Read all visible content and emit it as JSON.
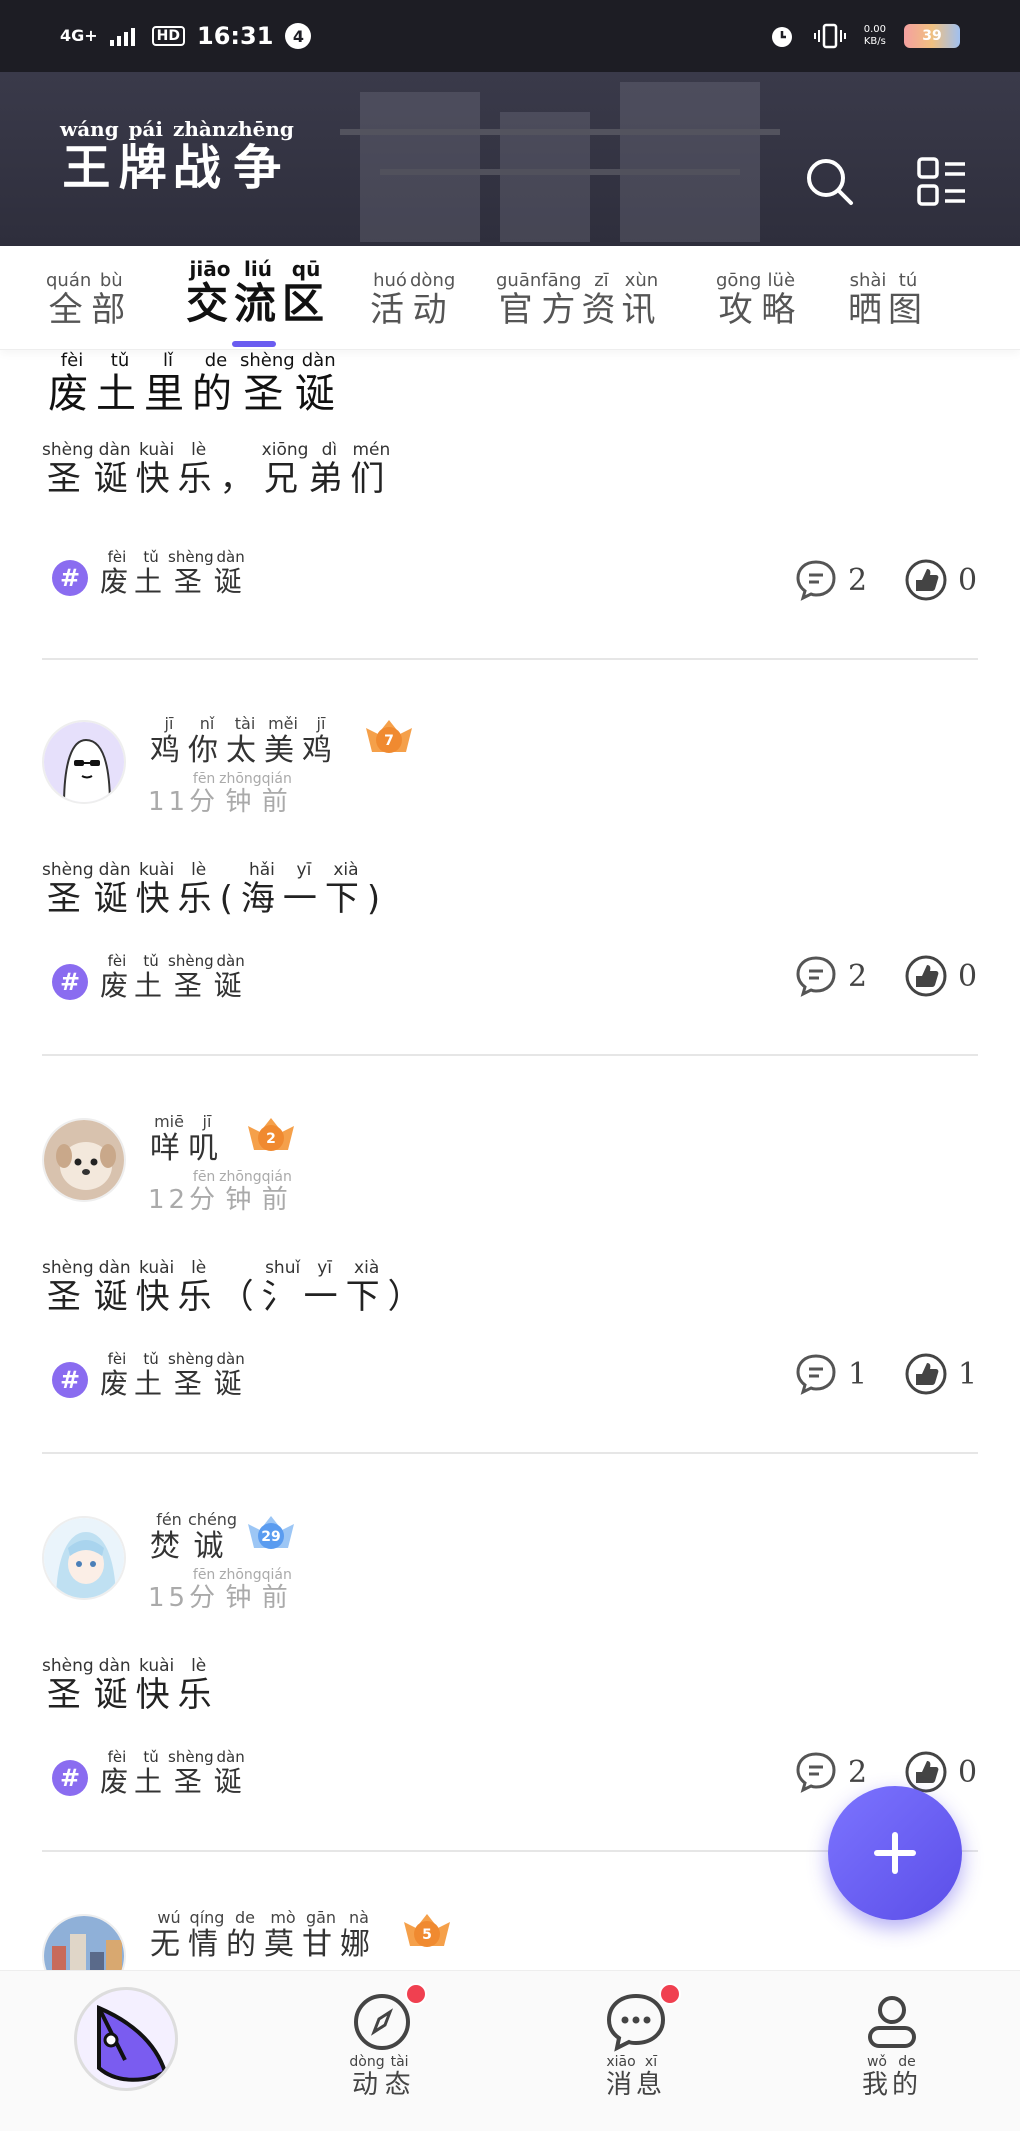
{
  "status_bar": {
    "network": "4G+",
    "hd": "HD",
    "time": "16:31",
    "notif_count": "4",
    "speed_value": "0.00",
    "speed_unit": "KB/s",
    "battery": "39"
  },
  "header": {
    "title_chars": [
      {
        "hz": "王",
        "py": "wáng"
      },
      {
        "hz": "牌",
        "py": "pái"
      },
      {
        "hz": "战",
        "py": "zhàn"
      },
      {
        "hz": "争",
        "py": "zhēng"
      }
    ],
    "search_icon": "search-icon",
    "menu_icon": "grid-menu-icon"
  },
  "tabs": [
    {
      "chars": [
        {
          "hz": "全",
          "py": "quán"
        },
        {
          "hz": "部",
          "py": "bù"
        }
      ]
    },
    {
      "chars": [
        {
          "hz": "交",
          "py": "jiāo"
        },
        {
          "hz": "流",
          "py": "liú"
        },
        {
          "hz": "区",
          "py": "qū"
        }
      ],
      "active": true
    },
    {
      "chars": [
        {
          "hz": "活",
          "py": "huó"
        },
        {
          "hz": "动",
          "py": "dòng"
        }
      ]
    },
    {
      "chars": [
        {
          "hz": "官",
          "py": "guān"
        },
        {
          "hz": "方",
          "py": "fāng"
        },
        {
          "hz": "资",
          "py": "zī"
        },
        {
          "hz": "讯",
          "py": "xùn"
        }
      ]
    },
    {
      "chars": [
        {
          "hz": "攻",
          "py": "gōng"
        },
        {
          "hz": "略",
          "py": "lüè"
        }
      ]
    },
    {
      "chars": [
        {
          "hz": "晒",
          "py": "shài"
        },
        {
          "hz": "图",
          "py": "tú"
        }
      ]
    }
  ],
  "posts": [
    {
      "title": [
        {
          "hz": "废",
          "py": "fèi"
        },
        {
          "hz": "土",
          "py": "tǔ"
        },
        {
          "hz": "里",
          "py": "lǐ"
        },
        {
          "hz": "的",
          "py": "de"
        },
        {
          "hz": "圣",
          "py": "shèng"
        },
        {
          "hz": "诞",
          "py": "dàn"
        }
      ],
      "text": [
        {
          "hz": "圣",
          "py": "shèng"
        },
        {
          "hz": "诞",
          "py": "dàn"
        },
        {
          "hz": "快",
          "py": "kuài"
        },
        {
          "hz": "乐",
          "py": "lè"
        },
        {
          "hz": "，",
          "py": ""
        },
        {
          "hz": "兄",
          "py": "xiōng"
        },
        {
          "hz": "弟",
          "py": "dì"
        },
        {
          "hz": "们",
          "py": "mén"
        }
      ],
      "topic": [
        {
          "hz": "废",
          "py": "fèi"
        },
        {
          "hz": "土",
          "py": "tǔ"
        },
        {
          "hz": "圣",
          "py": "shèng"
        },
        {
          "hz": "诞",
          "py": "dàn"
        }
      ],
      "comments": "2",
      "likes": "0"
    },
    {
      "user": [
        {
          "hz": "鸡",
          "py": "jī"
        },
        {
          "hz": "你",
          "py": "nǐ"
        },
        {
          "hz": "太",
          "py": "tài"
        },
        {
          "hz": "美",
          "py": "měi"
        },
        {
          "hz": "鸡",
          "py": "jī"
        }
      ],
      "level": "7",
      "time": [
        {
          "hz": "11",
          "py": ""
        },
        {
          "hz": "分",
          "py": "fēn"
        },
        {
          "hz": "钟",
          "py": "zhōng"
        },
        {
          "hz": "前",
          "py": "qián"
        }
      ],
      "text": [
        {
          "hz": "圣",
          "py": "shèng"
        },
        {
          "hz": "诞",
          "py": "dàn"
        },
        {
          "hz": "快",
          "py": "kuài"
        },
        {
          "hz": "乐",
          "py": "lè"
        },
        {
          "hz": "(",
          "py": ""
        },
        {
          "hz": "海",
          "py": "hǎi"
        },
        {
          "hz": "一",
          "py": "yī"
        },
        {
          "hz": "下",
          "py": "xià"
        },
        {
          "hz": ")",
          "py": ""
        }
      ],
      "topic": [
        {
          "hz": "废",
          "py": "fèi"
        },
        {
          "hz": "土",
          "py": "tǔ"
        },
        {
          "hz": "圣",
          "py": "shèng"
        },
        {
          "hz": "诞",
          "py": "dàn"
        }
      ],
      "comments": "2",
      "likes": "0"
    },
    {
      "user": [
        {
          "hz": "咩",
          "py": "miē"
        },
        {
          "hz": "叽",
          "py": "jī"
        }
      ],
      "level": "2",
      "time": [
        {
          "hz": "12",
          "py": ""
        },
        {
          "hz": "分",
          "py": "fēn"
        },
        {
          "hz": "钟",
          "py": "zhōng"
        },
        {
          "hz": "前",
          "py": "qián"
        }
      ],
      "text": [
        {
          "hz": "圣",
          "py": "shèng"
        },
        {
          "hz": "诞",
          "py": "dàn"
        },
        {
          "hz": "快",
          "py": "kuài"
        },
        {
          "hz": "乐",
          "py": "lè"
        },
        {
          "hz": "（",
          "py": ""
        },
        {
          "hz": "氵",
          "py": "shuǐ"
        },
        {
          "hz": "一",
          "py": "yī"
        },
        {
          "hz": "下",
          "py": "xià"
        },
        {
          "hz": "）",
          "py": ""
        }
      ],
      "topic": [
        {
          "hz": "废",
          "py": "fèi"
        },
        {
          "hz": "土",
          "py": "tǔ"
        },
        {
          "hz": "圣",
          "py": "shèng"
        },
        {
          "hz": "诞",
          "py": "dàn"
        }
      ],
      "comments": "1",
      "likes": "1"
    },
    {
      "user": [
        {
          "hz": "焚",
          "py": "fén"
        },
        {
          "hz": "诚",
          "py": "chéng"
        }
      ],
      "level": "29",
      "time": [
        {
          "hz": "15",
          "py": ""
        },
        {
          "hz": "分",
          "py": "fēn"
        },
        {
          "hz": "钟",
          "py": "zhōng"
        },
        {
          "hz": "前",
          "py": "qián"
        }
      ],
      "text": [
        {
          "hz": "圣",
          "py": "shèng"
        },
        {
          "hz": "诞",
          "py": "dàn"
        },
        {
          "hz": "快",
          "py": "kuài"
        },
        {
          "hz": "乐",
          "py": "lè"
        }
      ],
      "topic": [
        {
          "hz": "废",
          "py": "fèi"
        },
        {
          "hz": "土",
          "py": "tǔ"
        },
        {
          "hz": "圣",
          "py": "shèng"
        },
        {
          "hz": "诞",
          "py": "dàn"
        }
      ],
      "comments": "2",
      "likes": "0"
    },
    {
      "user": [
        {
          "hz": "无",
          "py": "wú"
        },
        {
          "hz": "情",
          "py": "qíng"
        },
        {
          "hz": "的",
          "py": "de"
        },
        {
          "hz": "莫",
          "py": "mò"
        },
        {
          "hz": "甘",
          "py": "gān"
        },
        {
          "hz": "娜",
          "py": "nà"
        }
      ],
      "level": "5"
    }
  ],
  "bottom_nav": [
    {
      "name": "home",
      "chars": []
    },
    {
      "name": "feed",
      "chars": [
        {
          "hz": "动",
          "py": "dòng"
        },
        {
          "hz": "态",
          "py": "tài"
        }
      ],
      "badge": true
    },
    {
      "name": "messages",
      "chars": [
        {
          "hz": "消",
          "py": "xiāo"
        },
        {
          "hz": "息",
          "py": "xī"
        }
      ],
      "badge": true
    },
    {
      "name": "profile",
      "chars": [
        {
          "hz": "我",
          "py": "wǒ"
        },
        {
          "hz": "的",
          "py": "de"
        }
      ]
    }
  ],
  "colors": {
    "accent": "#6a5cf0",
    "header_bg": "#2e2e3c",
    "badge_red": "#f04050",
    "topic_purple": "#8a6cf0",
    "level_orange": "#f08a30",
    "level_blue": "#5a9cf0"
  }
}
